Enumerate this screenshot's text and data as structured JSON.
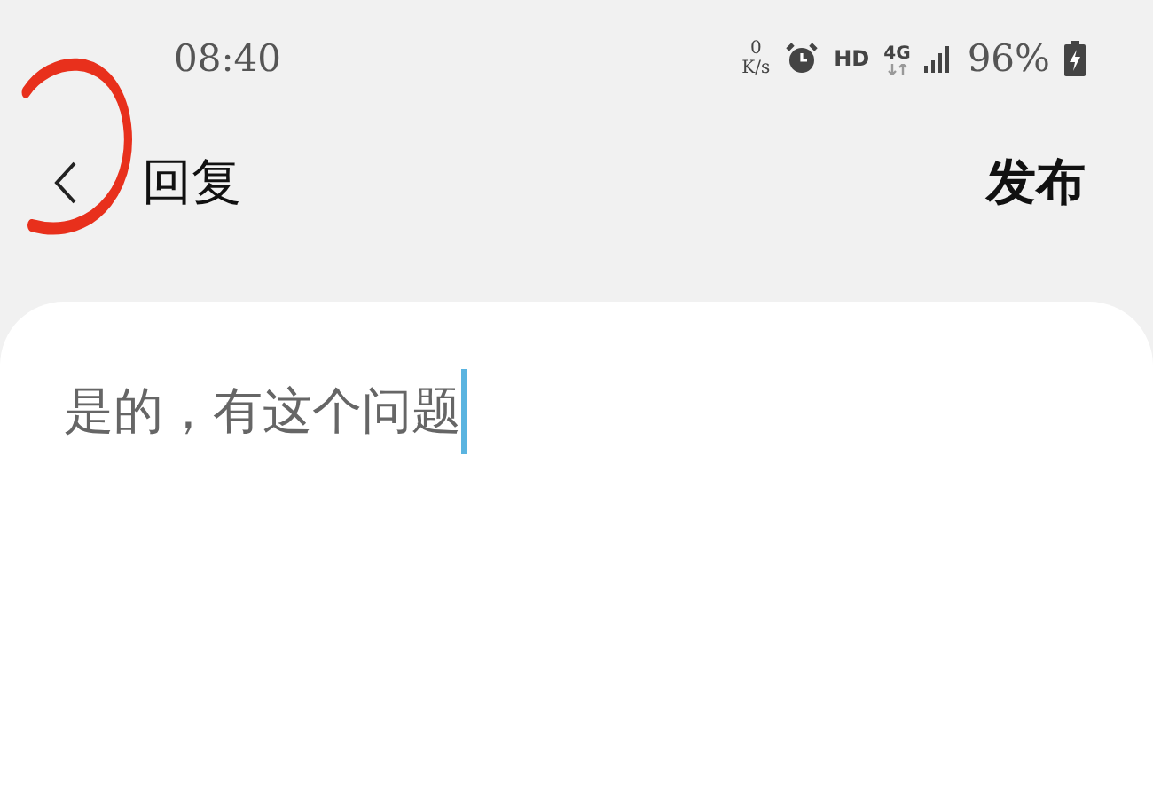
{
  "status_bar": {
    "time": "08:40",
    "speed_value": "0",
    "speed_unit": "K/s",
    "hd": "HD",
    "network": "4G",
    "battery": "96%"
  },
  "header": {
    "title": "回复",
    "action": "发布"
  },
  "editor": {
    "value": "是的，有这个问题"
  }
}
